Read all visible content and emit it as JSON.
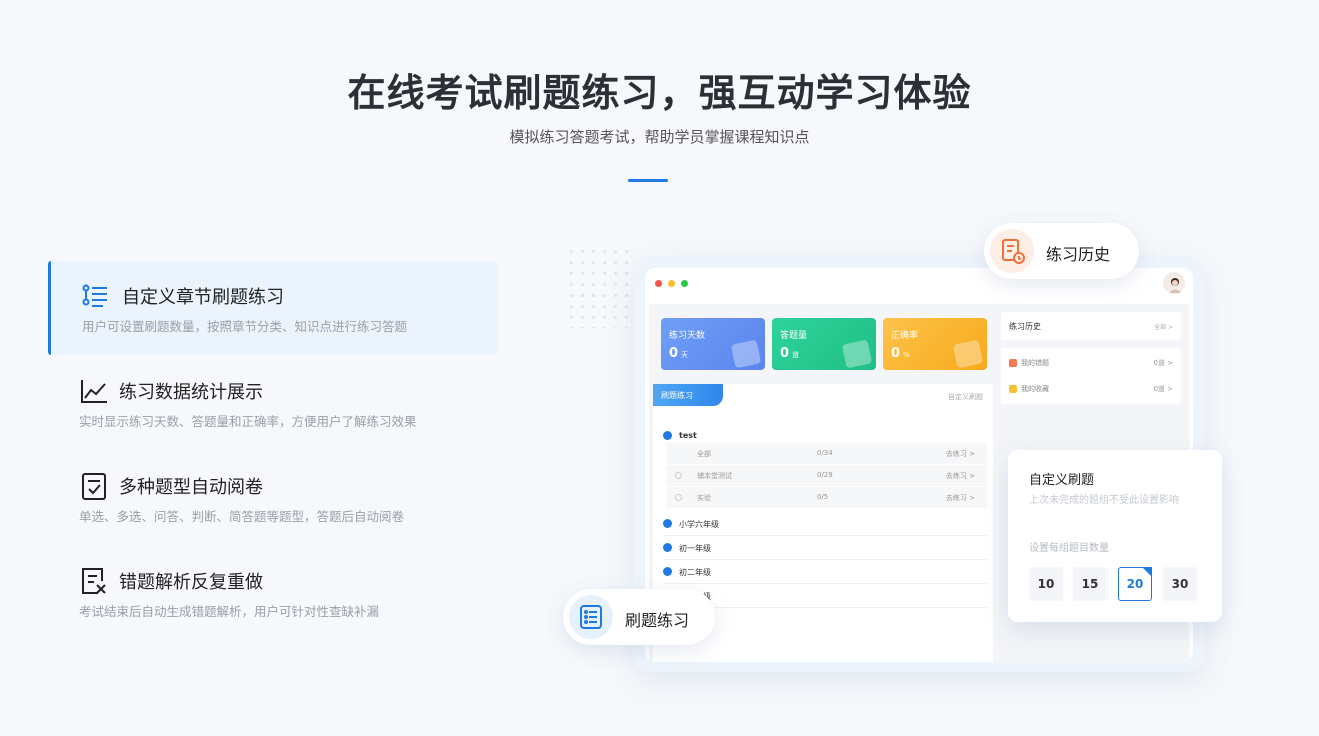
{
  "hero": {
    "title": "在线考试刷题练习，强互动学习体验",
    "subtitle": "模拟练习答题考试，帮助学员掌握课程知识点"
  },
  "features": [
    {
      "title": "自定义章节刷题练习",
      "desc": "用户可设置刷题数量，按照章节分类、知识点进行练习答题",
      "icon": "list-steps-icon"
    },
    {
      "title": "练习数据统计展示",
      "desc": "实时显示练习天数、答题量和正确率，方便用户了解练习效果",
      "icon": "line-chart-icon"
    },
    {
      "title": "多种题型自动阅卷",
      "desc": "单选、多选、问答、判断、简答题等题型，答题后自动阅卷",
      "icon": "checklist-icon"
    },
    {
      "title": "错题解析反复重做",
      "desc": "考试结束后自动生成错题解析，用户可针对性查缺补漏",
      "icon": "wrong-doc-icon"
    }
  ],
  "mock": {
    "stats": [
      {
        "label": "练习天数",
        "value": "0",
        "unit": "天",
        "color": "#5b8ef0"
      },
      {
        "label": "答题量",
        "value": "0",
        "unit": "道",
        "color": "#22c78e"
      },
      {
        "label": "正确率",
        "value": "0",
        "unit": "%",
        "color": "#fbb32a"
      }
    ],
    "practice_tab": "刷题练习",
    "custom_link": "自定义刷题",
    "categories": [
      "test",
      "小学六年级",
      "初一年级",
      "初二年级",
      "初三年级"
    ],
    "sub_rows": [
      {
        "name": "全部",
        "progress": "0/34",
        "action": "去练习 >"
      },
      {
        "name": "辅本堂测试",
        "progress": "0/29",
        "action": "去练习 >"
      },
      {
        "name": "实验",
        "progress": "0/5",
        "action": "去练习 >"
      }
    ],
    "history_title": "练习历史",
    "history_more": "全部 >",
    "side_items": [
      {
        "label": "我的错题",
        "count": "0道 >",
        "color": "#f37a4c"
      },
      {
        "label": "我的收藏",
        "count": "0道 >",
        "color": "#f8c331"
      }
    ]
  },
  "badges": {
    "history": "练习历史",
    "practice": "刷题练习"
  },
  "custom_popup": {
    "title": "自定义刷题",
    "subtitle": "上次未完成的题组不受此设置影响",
    "hint": "设置每组题目数量",
    "options": [
      "10",
      "15",
      "20",
      "30"
    ],
    "selected": "20"
  },
  "colors": {
    "accent": "#1f7ae0",
    "active_bg": "#eaf3fe"
  }
}
